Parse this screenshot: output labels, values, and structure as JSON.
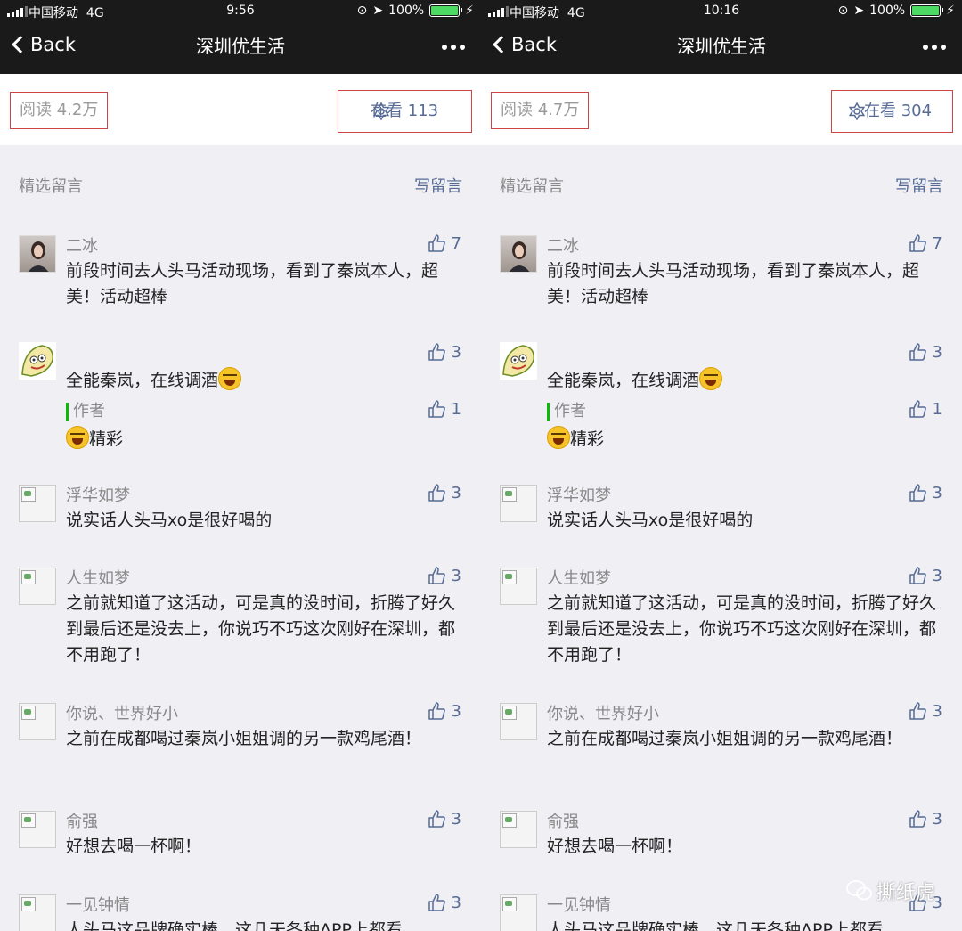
{
  "screens": [
    {
      "status": {
        "carrier": "中国移动",
        "network": "4G",
        "time": "9:56",
        "battery": "100%"
      },
      "nav": {
        "back": "Back",
        "title": "深圳优生活"
      },
      "stats": {
        "reads": "阅读 4.2万",
        "watching_label": "在看",
        "watching_count": "113"
      },
      "section": {
        "label": "精选留言",
        "write": "写留言"
      },
      "comments": [
        {
          "name": "二冰",
          "likes": "7",
          "text": "前段时间去人头马活动现场，看到了秦岚本人，超美！活动超棒"
        },
        {
          "name": "",
          "likes": "3",
          "text": "全能秦岚，在线调酒",
          "reply_label": "作者",
          "reply_likes": "1",
          "reply_text": "精彩"
        },
        {
          "name": "浮华如梦",
          "likes": "3",
          "text": "说实话人头马xo是很好喝的"
        },
        {
          "name": "人生如梦",
          "likes": "3",
          "text": "之前就知道了这活动，可是真的没时间，折腾了好久到最后还是没去上，你说巧不巧这次刚好在深圳，都不用跑了！"
        },
        {
          "name": "你说、世界好小",
          "likes": "3",
          "text": "之前在成都喝过秦岚小姐姐调的另一款鸡尾酒！"
        },
        {
          "name": "俞强",
          "likes": "3",
          "text": "好想去喝一杯啊！"
        },
        {
          "name": "一见钟情",
          "likes": "3",
          "text": "人头马这品牌确实棒，这几天各种APP上都看"
        }
      ]
    },
    {
      "status": {
        "carrier": "中国移动",
        "network": "4G",
        "time": "10:16",
        "battery": "100%"
      },
      "nav": {
        "back": "Back",
        "title": "深圳优生活"
      },
      "stats": {
        "reads": "阅读 4.7万",
        "watching_label": "在看",
        "watching_count": "304"
      },
      "section": {
        "label": "精选留言",
        "write": "写留言"
      },
      "comments": [
        {
          "name": "二冰",
          "likes": "7",
          "text": "前段时间去人头马活动现场，看到了秦岚本人，超美！活动超棒"
        },
        {
          "name": "",
          "likes": "3",
          "text": "全能秦岚，在线调酒",
          "reply_label": "作者",
          "reply_likes": "1",
          "reply_text": "精彩"
        },
        {
          "name": "浮华如梦",
          "likes": "3",
          "text": "说实话人头马xo是很好喝的"
        },
        {
          "name": "人生如梦",
          "likes": "3",
          "text": "之前就知道了这活动，可是真的没时间，折腾了好久到最后还是没去上，你说巧不巧这次刚好在深圳，都不用跑了！"
        },
        {
          "name": "你说、世界好小",
          "likes": "3",
          "text": "之前在成都喝过秦岚小姐姐调的另一款鸡尾酒！"
        },
        {
          "name": "俞强",
          "likes": "3",
          "text": "好想去喝一杯啊！"
        },
        {
          "name": "一见钟情",
          "likes": "3",
          "text": "人头马这品牌确实棒，这几天各种APP上都看"
        }
      ]
    }
  ],
  "watermark": "撕纸虎",
  "icons": {
    "signal": "signal-icon",
    "battery": "battery-icon",
    "back": "chevron-left-icon",
    "more": "more-icon",
    "watching": "flower-icon",
    "like": "thumbs-up-icon",
    "emoji": "laughing-emoji-icon",
    "wechat": "wechat-icon"
  },
  "colors": {
    "navbar": "#1a1a1a",
    "link": "#576b95",
    "highlight_box": "#cc4444",
    "author_bar": "#09bb07"
  }
}
